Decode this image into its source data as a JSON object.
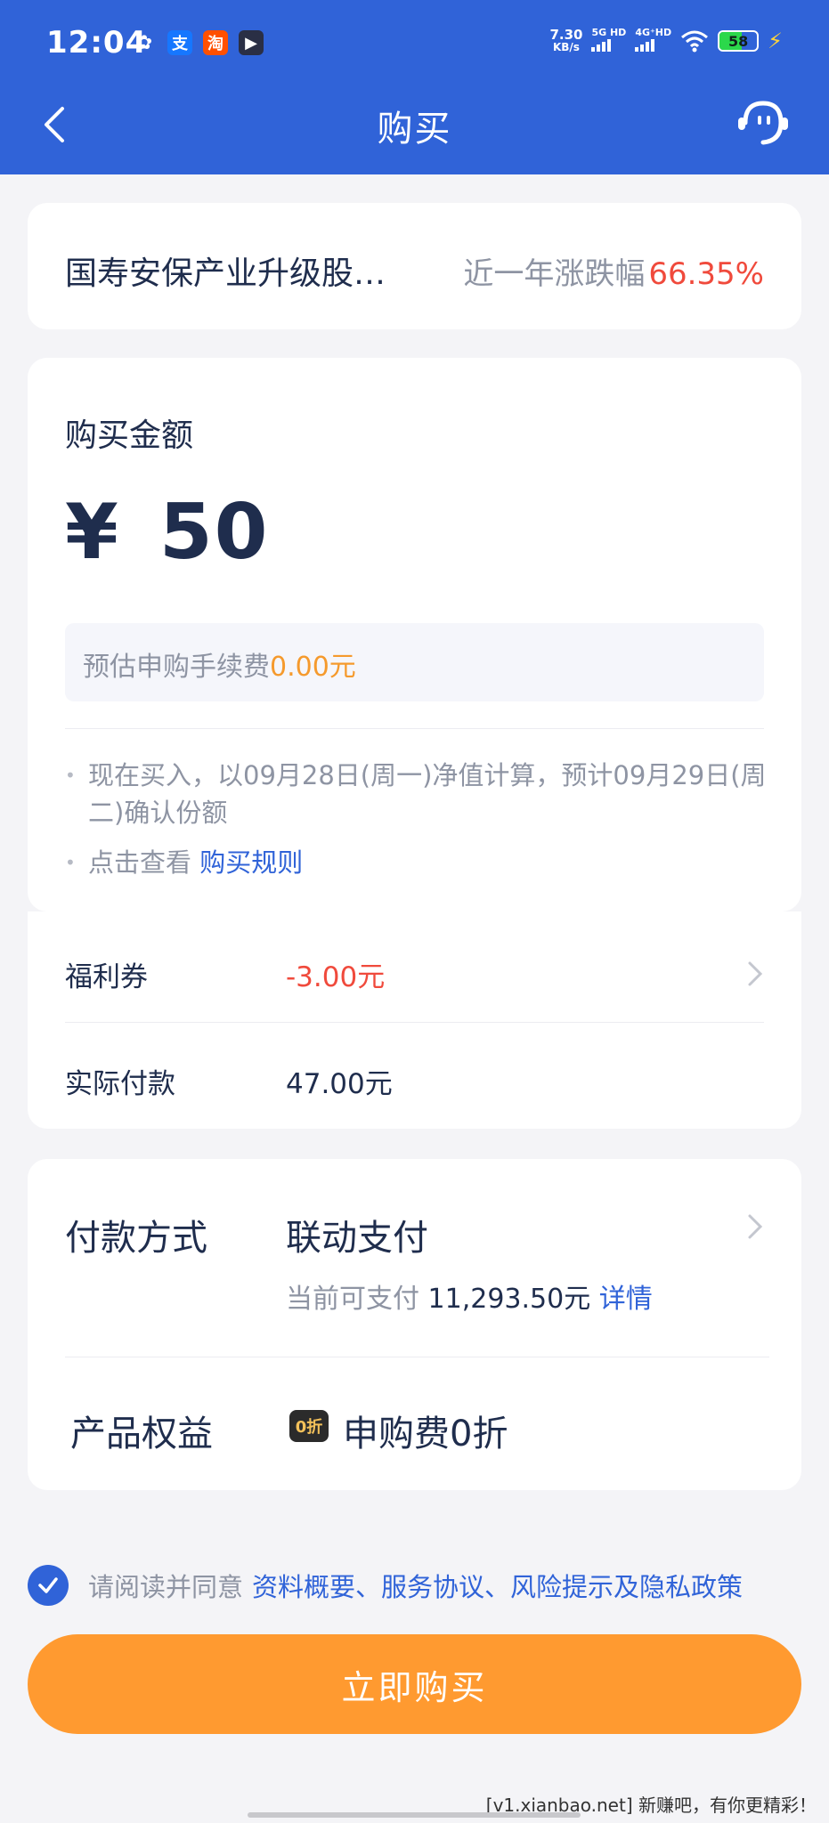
{
  "status_bar": {
    "time": "12:04",
    "notifications": [
      {
        "icon": "wechat-icon",
        "glyph": "✿"
      },
      {
        "icon": "alipay-icon",
        "glyph": "支"
      },
      {
        "icon": "taobao-icon",
        "glyph": "淘"
      },
      {
        "icon": "video-app-icon",
        "glyph": "▶"
      }
    ],
    "net_speed_value": "7.30",
    "net_speed_unit": "KB/s",
    "signal_1_label": "5G HD",
    "signal_2_label": "4G⁺HD",
    "battery": "58"
  },
  "header": {
    "title": "购买",
    "back_icon": "back-arrow-icon",
    "service_icon": "customer-service-icon"
  },
  "fund": {
    "name": "国寿安保产业升级股…",
    "perf_label": "近一年涨跌幅",
    "perf_value": "66.35%"
  },
  "amount": {
    "label": "购买金额",
    "currency": "¥",
    "value": "50",
    "fee_label": "预估申购手续费",
    "fee_value": "0.00元",
    "note_1": "现在买入，以09月28日(周一)净值计算，预计09月29日(周二)确认份额",
    "note_2_prefix": "点击查看",
    "note_2_link": "购买规则"
  },
  "payment": {
    "coupon_label": "福利券",
    "coupon_value": "-3.00元",
    "actual_label": "实际付款",
    "actual_value": "47.00元"
  },
  "method": {
    "label": "付款方式",
    "value": "联动支付",
    "balance_prefix": "当前可支付",
    "balance_value": "11,293.50元",
    "details_link": "详情",
    "benefit_label": "产品权益",
    "benefit_badge": "0折",
    "benefit_value": "申购费0折"
  },
  "agreement": {
    "prefix": "请阅读并同意",
    "links": "资料概要、服务协议、风险提示及隐私政策"
  },
  "buy_button": "立即购买",
  "watermark": "[v1.xianbao.net] 新赚吧，有你更精彩！",
  "colors": {
    "brand_blue": "#3063d8",
    "accent_orange": "#ff9a30",
    "alert_red": "#f04a3c",
    "fee_orange": "#f59a2d"
  }
}
